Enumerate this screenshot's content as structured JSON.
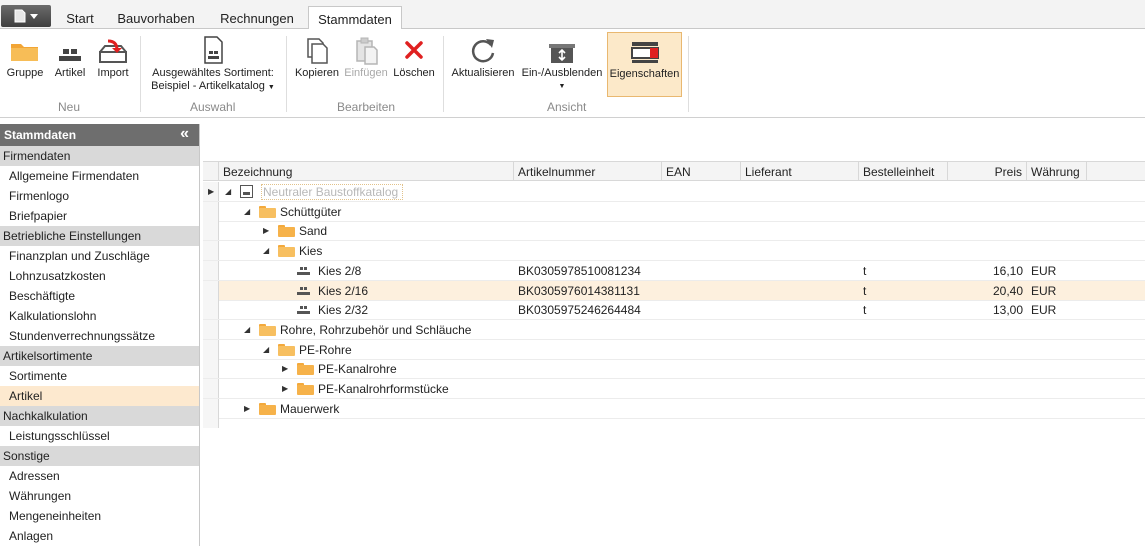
{
  "menu": {
    "tabs": [
      "Start",
      "Bauvorhaben",
      "Rechnungen",
      "Stammdaten"
    ],
    "active_tab": "Stammdaten"
  },
  "ribbon": {
    "neu": {
      "group_label": "Neu",
      "gruppe": "Gruppe",
      "artikel": "Artikel",
      "import": "Import"
    },
    "auswahl": {
      "group_label": "Auswahl",
      "line1": "Ausgewähltes Sortiment:",
      "line2": "Beispiel - Artikelkatalog"
    },
    "bearbeiten": {
      "group_label": "Bearbeiten",
      "kopieren": "Kopieren",
      "einfuegen": "Einfügen",
      "loeschen": "Löschen"
    },
    "ansicht": {
      "group_label": "Ansicht",
      "aktualisieren": "Aktualisieren",
      "einausblenden": "Ein-/Ausblenden",
      "eigenschaften": "Eigenschaften"
    }
  },
  "sidebar": {
    "title": "Stammdaten",
    "groups": [
      {
        "label": "Firmendaten",
        "items": [
          "Allgemeine Firmendaten",
          "Firmenlogo",
          "Briefpapier"
        ]
      },
      {
        "label": "Betriebliche Einstellungen",
        "items": [
          "Finanzplan und Zuschläge",
          "Lohnzusatzkosten",
          "Beschäftigte",
          "Kalkulationslohn",
          "Stundenverrechnungssätze"
        ]
      },
      {
        "label": "Artikelsortimente",
        "items": [
          "Sortimente",
          "Artikel"
        ]
      },
      {
        "label": "Nachkalkulation",
        "items": [
          "Leistungsschlüssel"
        ]
      },
      {
        "label": "Sonstige",
        "items": [
          "Adressen",
          "Währungen",
          "Mengeneinheiten",
          "Anlagen"
        ]
      }
    ],
    "selected_item": "Artikel"
  },
  "grid": {
    "columns": [
      "Bezeichnung",
      "Artikelnummer",
      "EAN",
      "Lieferant",
      "Bestelleinheit",
      "Preis",
      "Währung"
    ],
    "rows": [
      {
        "name": "Neutraler Baustoffkatalog",
        "type": "catalog",
        "expander": "◢",
        "artnr": "",
        "einheit": "",
        "preis": "",
        "waehrung": ""
      },
      {
        "name": "Schüttgüter",
        "type": "folder-open",
        "expander": "◢",
        "artnr": "",
        "einheit": "",
        "preis": "",
        "waehrung": ""
      },
      {
        "name": "Sand",
        "type": "folder",
        "expander": "▶",
        "artnr": "",
        "einheit": "",
        "preis": "",
        "waehrung": ""
      },
      {
        "name": "Kies",
        "type": "folder-open",
        "expander": "◢",
        "artnr": "",
        "einheit": "",
        "preis": "",
        "waehrung": ""
      },
      {
        "name": "Kies 2/8",
        "type": "article",
        "expander": "",
        "artnr": "BK0305978510081234",
        "einheit": "t",
        "preis": "16,10",
        "waehrung": "EUR"
      },
      {
        "name": "Kies 2/16",
        "type": "article",
        "expander": "",
        "artnr": "BK0305976014381131",
        "einheit": "t",
        "preis": "20,40",
        "waehrung": "EUR"
      },
      {
        "name": "Kies 2/32",
        "type": "article",
        "expander": "",
        "artnr": "BK0305975246264484",
        "einheit": "t",
        "preis": "13,00",
        "waehrung": "EUR"
      },
      {
        "name": "Rohre, Rohrzubehör und Schläuche",
        "type": "folder-open",
        "expander": "◢",
        "artnr": "",
        "einheit": "",
        "preis": "",
        "waehrung": ""
      },
      {
        "name": "PE-Rohre",
        "type": "folder-open",
        "expander": "◢",
        "artnr": "",
        "einheit": "",
        "preis": "",
        "waehrung": ""
      },
      {
        "name": "PE-Kanalrohre",
        "type": "folder",
        "expander": "▶",
        "artnr": "",
        "einheit": "",
        "preis": "",
        "waehrung": ""
      },
      {
        "name": "PE-Kanalrohrformstücke",
        "type": "folder",
        "expander": "▶",
        "artnr": "",
        "einheit": "",
        "preis": "",
        "waehrung": ""
      },
      {
        "name": "Mauerwerk",
        "type": "folder",
        "expander": "▶",
        "artnr": "",
        "einheit": "",
        "preis": "",
        "waehrung": ""
      }
    ]
  },
  "colors": {
    "accent": "#f6b24a",
    "selection": "#fdf0de",
    "sidebar_header": "#6e6e6e",
    "delete_red": "#e02020"
  }
}
